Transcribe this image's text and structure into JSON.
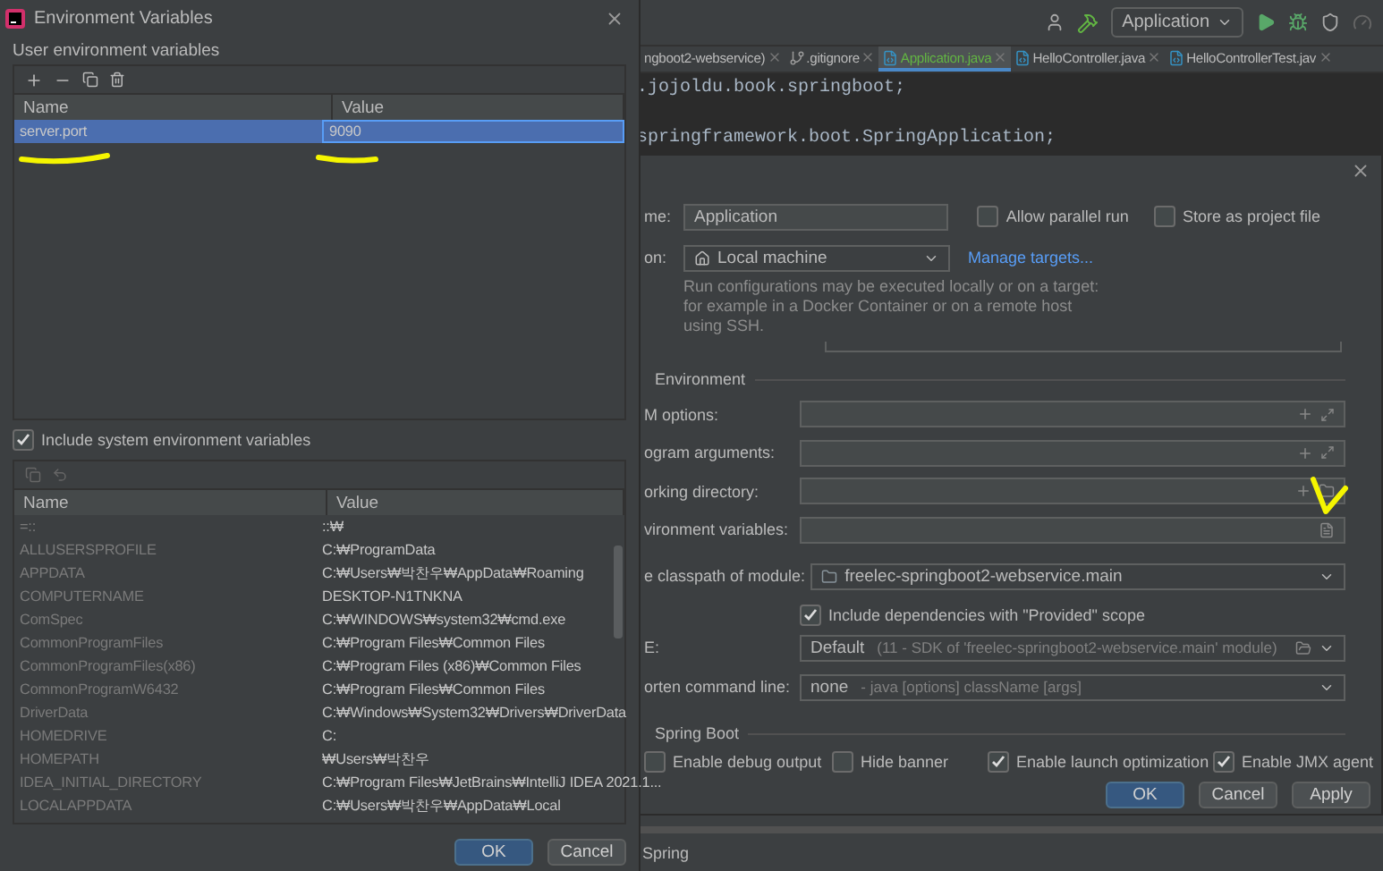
{
  "ide": {
    "toolbar": {
      "run_config": "Application"
    },
    "tabs": [
      {
        "label": "ngboot2-webservice)",
        "kind": "plain",
        "selected": false
      },
      {
        "label": ".gitignore",
        "kind": "ignore",
        "selected": false
      },
      {
        "label": "Application.java",
        "kind": "app",
        "selected": true
      },
      {
        "label": "HelloController.java",
        "kind": "class",
        "selected": false
      },
      {
        "label": "HelloControllerTest.jav",
        "kind": "test",
        "selected": false
      }
    ],
    "code_lines": [
      ".jojoldu.book.springboot;",
      "springframework.boot.SpringApplication;"
    ]
  },
  "run_dialog": {
    "name": {
      "label": "me:",
      "value": "Application"
    },
    "options": [
      {
        "label": "Allow parallel run",
        "checked": false
      },
      {
        "label": "Store as project file",
        "checked": false
      }
    ],
    "target": {
      "label": "on:",
      "value": "Local machine",
      "link": "Manage targets..."
    },
    "info": "Run configurations may be executed locally or on a target: for example in a Docker Container or on a remote host using SSH.",
    "environment": {
      "title": "Environment",
      "fields": [
        {
          "label": "M options:",
          "kind": "expand"
        },
        {
          "label": "ogram arguments:",
          "kind": "expand"
        },
        {
          "label": "orking directory:",
          "kind": "folder"
        },
        {
          "label": "vironment variables:",
          "kind": "document"
        }
      ]
    },
    "classpath": {
      "label": "e classpath of module:",
      "value": "freelec-springboot2-webservice.main"
    },
    "include_dependencies": {
      "label": "Include dependencies with \"Provided\" scope",
      "checked": true
    },
    "jre": {
      "label": "E:",
      "value": "Default",
      "hint": "(11 - SDK of 'freelec-springboot2-webservice.main' module)"
    },
    "shorten": {
      "label": "orten command line:",
      "value": "none",
      "hint": "- java [options] className [args]"
    },
    "spring_boot": {
      "title": "Spring Boot",
      "options": [
        {
          "label": "Enable debug output",
          "checked": false
        },
        {
          "label": "Hide banner",
          "checked": false
        },
        {
          "label": "Enable launch optimization",
          "checked": true
        },
        {
          "label": "Enable JMX agent",
          "checked": true
        }
      ]
    },
    "buttons": [
      {
        "label": "OK",
        "kind": "primary"
      },
      {
        "label": "Cancel",
        "kind": "default"
      },
      {
        "label": "Apply",
        "kind": "default"
      }
    ]
  },
  "status_bar": {
    "text": "Spring"
  },
  "env_dialog": {
    "title": "Environment Variables",
    "user_label": "User environment variables",
    "user_table": {
      "columns": [
        "Name",
        "Value"
      ],
      "rows": [
        {
          "name": "server.port",
          "value": "9090",
          "selected": true
        }
      ]
    },
    "include_system": {
      "label": "Include system environment variables",
      "checked": true
    },
    "system_table": {
      "columns": [
        "Name",
        "Value"
      ],
      "rows": [
        {
          "name": "=::",
          "value": "::₩"
        },
        {
          "name": "ALLUSERSPROFILE",
          "value": "C:₩ProgramData"
        },
        {
          "name": "APPDATA",
          "value": "C:₩Users₩박찬우₩AppData₩Roaming"
        },
        {
          "name": "COMPUTERNAME",
          "value": "DESKTOP-N1TNKNA"
        },
        {
          "name": "ComSpec",
          "value": "C:₩WINDOWS₩system32₩cmd.exe"
        },
        {
          "name": "CommonProgramFiles",
          "value": "C:₩Program Files₩Common Files"
        },
        {
          "name": "CommonProgramFiles(x86)",
          "value": "C:₩Program Files (x86)₩Common Files"
        },
        {
          "name": "CommonProgramW6432",
          "value": "C:₩Program Files₩Common Files"
        },
        {
          "name": "DriverData",
          "value": "C:₩Windows₩System32₩Drivers₩DriverData"
        },
        {
          "name": "HOMEDRIVE",
          "value": "C:"
        },
        {
          "name": "HOMEPATH",
          "value": "₩Users₩박찬우"
        },
        {
          "name": "IDEA_INITIAL_DIRECTORY",
          "value": "C:₩Program Files₩JetBrains₩IntelliJ IDEA 2021.1..."
        },
        {
          "name": "LOCALAPPDATA",
          "value": "C:₩Users₩박찬우₩AppData₩Local"
        }
      ]
    },
    "buttons": [
      {
        "label": "OK",
        "kind": "primary"
      },
      {
        "label": "Cancel",
        "kind": "default"
      }
    ]
  }
}
